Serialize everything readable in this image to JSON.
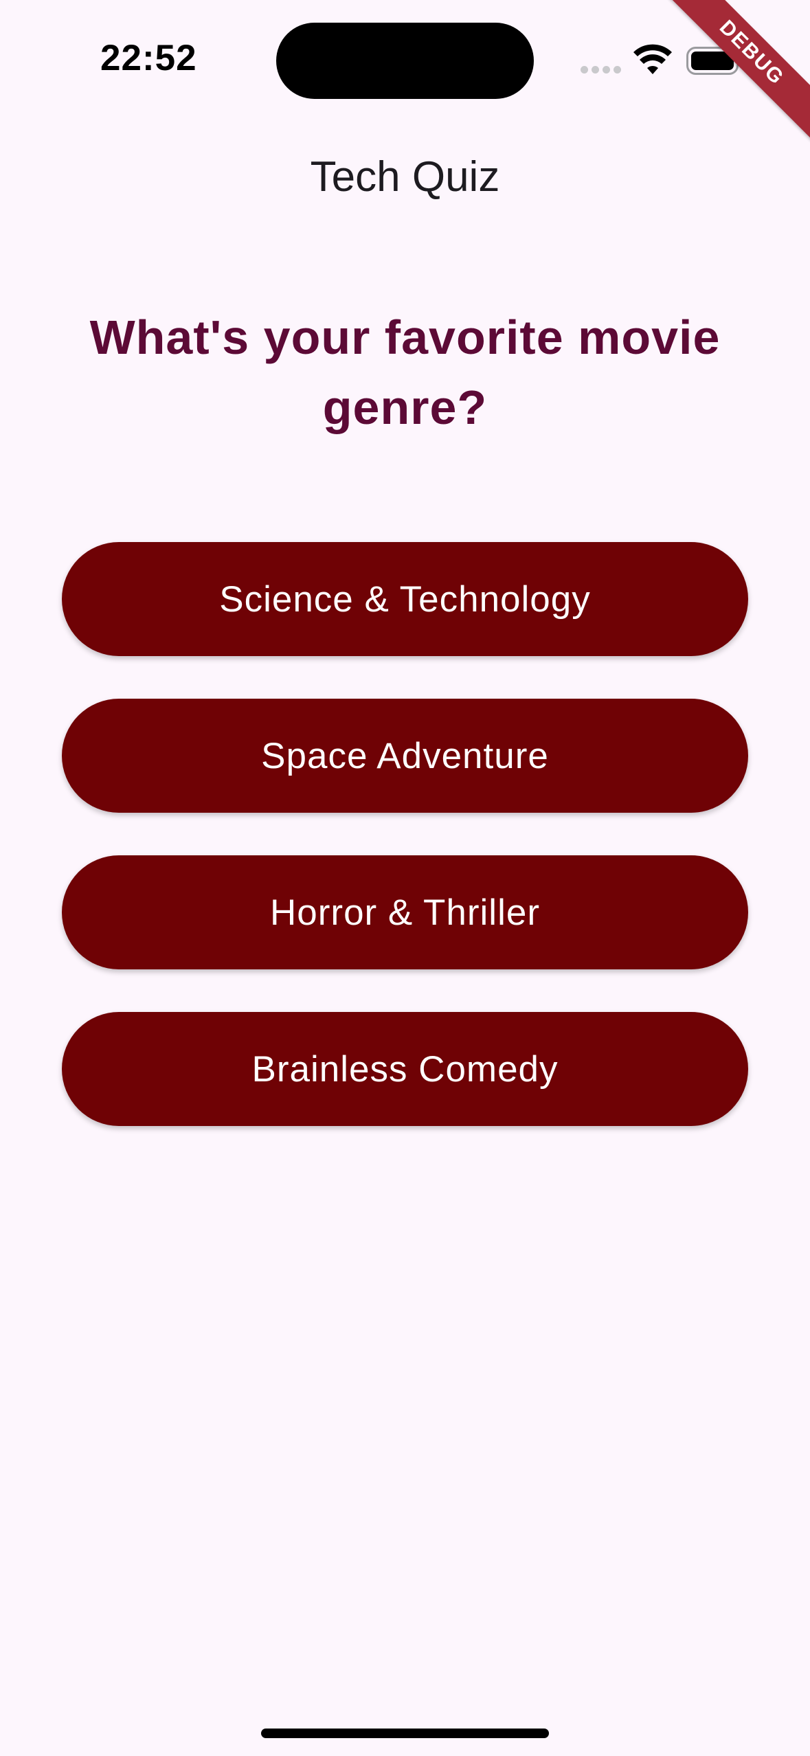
{
  "status_bar": {
    "time": "22:52",
    "signal_icon": "cellular-dots-icon",
    "wifi_icon": "wifi-icon",
    "battery_icon": "battery-icon"
  },
  "debug_banner": "DEBUG",
  "app_bar": {
    "title": "Tech Quiz"
  },
  "quiz": {
    "question": "What's your favorite movie genre?",
    "answers": [
      "Science & Technology",
      "Space Adventure",
      "Horror & Thriller",
      "Brainless Comedy"
    ]
  },
  "colors": {
    "background": "#fdf6fd",
    "question_text": "#5c0a36",
    "button_background": "#6f0205",
    "button_text": "#ffffff",
    "debug_banner": "#a52a37"
  }
}
